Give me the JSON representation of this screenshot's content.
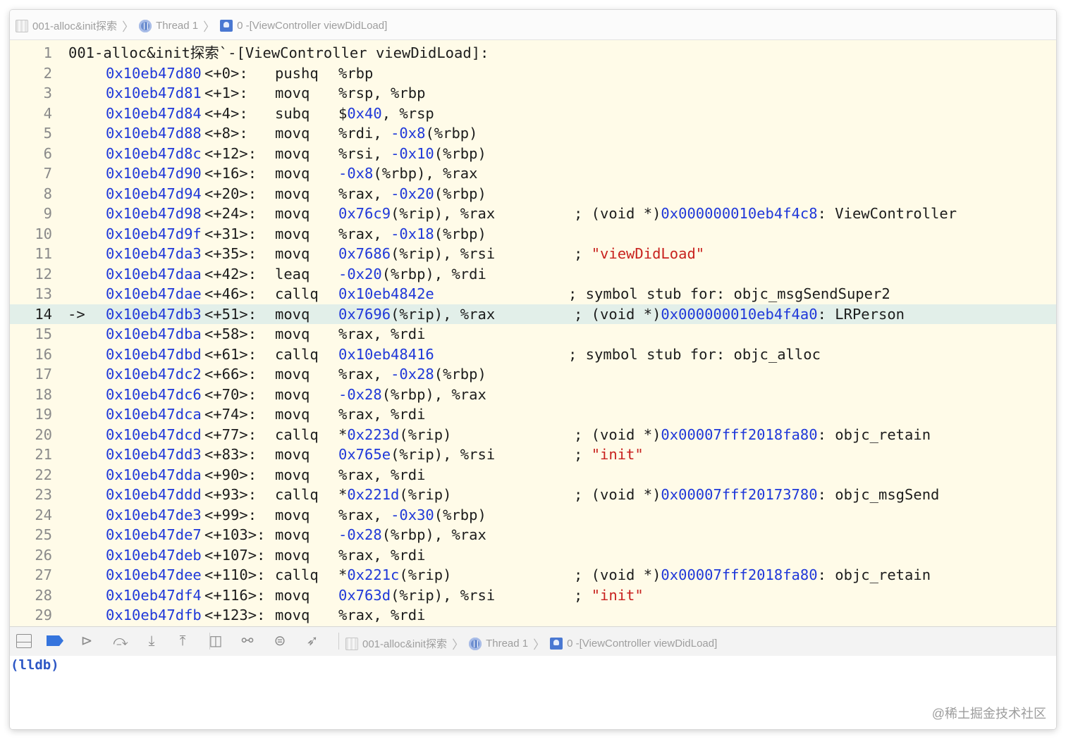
{
  "breadcrumb": {
    "project": "001-alloc&init探索",
    "thread": "Thread 1",
    "frame": "0 -[ViewController viewDidLoad]"
  },
  "editor": {
    "header": "001-alloc&init探索`-[ViewController viewDidLoad]:",
    "current_line": 14,
    "lines": [
      {
        "n": "1"
      },
      {
        "n": "2",
        "addr": "0x10eb47d80",
        "off": "<+0>:",
        "ins": "pushq",
        "args": [
          {
            "t": "%rbp"
          }
        ]
      },
      {
        "n": "3",
        "addr": "0x10eb47d81",
        "off": "<+1>:",
        "ins": "movq",
        "args": [
          {
            "t": "%rsp, %rbp"
          }
        ]
      },
      {
        "n": "4",
        "addr": "0x10eb47d84",
        "off": "<+4>:",
        "ins": "subq",
        "args": [
          {
            "t": "$"
          },
          {
            "t": "0x40",
            "c": "hex"
          },
          {
            "t": ", %rsp"
          }
        ]
      },
      {
        "n": "5",
        "addr": "0x10eb47d88",
        "off": "<+8>:",
        "ins": "movq",
        "args": [
          {
            "t": "%rdi, "
          },
          {
            "t": "-0x8",
            "c": "hex"
          },
          {
            "t": "(%rbp)"
          }
        ]
      },
      {
        "n": "6",
        "addr": "0x10eb47d8c",
        "off": "<+12>:",
        "ins": "movq",
        "args": [
          {
            "t": "%rsi, "
          },
          {
            "t": "-0x10",
            "c": "hex"
          },
          {
            "t": "(%rbp)"
          }
        ]
      },
      {
        "n": "7",
        "addr": "0x10eb47d90",
        "off": "<+16>:",
        "ins": "movq",
        "args": [
          {
            "t": "-0x8",
            "c": "hex"
          },
          {
            "t": "(%rbp), %rax"
          }
        ]
      },
      {
        "n": "8",
        "addr": "0x10eb47d94",
        "off": "<+20>:",
        "ins": "movq",
        "args": [
          {
            "t": "%rax, "
          },
          {
            "t": "-0x20",
            "c": "hex"
          },
          {
            "t": "(%rbp)"
          }
        ]
      },
      {
        "n": "9",
        "addr": "0x10eb47d98",
        "off": "<+24>:",
        "ins": "movq",
        "args": [
          {
            "t": "0x76c9",
            "c": "hex"
          },
          {
            "t": "(%rip), %rax"
          }
        ],
        "cpos": "far",
        "comment": [
          {
            "t": "; (void *)"
          },
          {
            "t": "0x000000010eb4f4c8",
            "c": "hex"
          },
          {
            "t": ": ViewController"
          }
        ]
      },
      {
        "n": "10",
        "addr": "0x10eb47d9f",
        "off": "<+31>:",
        "ins": "movq",
        "args": [
          {
            "t": "%rax, "
          },
          {
            "t": "-0x18",
            "c": "hex"
          },
          {
            "t": "(%rbp)"
          }
        ]
      },
      {
        "n": "11",
        "addr": "0x10eb47da3",
        "off": "<+35>:",
        "ins": "movq",
        "args": [
          {
            "t": "0x7686",
            "c": "hex"
          },
          {
            "t": "(%rip), %rsi"
          }
        ],
        "cpos": "far",
        "comment": [
          {
            "t": "; "
          },
          {
            "t": "\"viewDidLoad\"",
            "c": "str"
          }
        ]
      },
      {
        "n": "12",
        "addr": "0x10eb47daa",
        "off": "<+42>:",
        "ins": "leaq",
        "args": [
          {
            "t": "-0x20",
            "c": "hex"
          },
          {
            "t": "(%rbp), %rdi"
          }
        ]
      },
      {
        "n": "13",
        "addr": "0x10eb47dae",
        "off": "<+46>:",
        "ins": "callq",
        "args": [
          {
            "t": "0x10eb4842e",
            "c": "hex"
          }
        ],
        "cpos": "near",
        "comment": [
          {
            "t": "; symbol stub for: objc_msgSendSuper2"
          }
        ]
      },
      {
        "n": "14",
        "arrow": "->",
        "addr": "0x10eb47db3",
        "off": "<+51>:",
        "ins": "movq",
        "args": [
          {
            "t": "0x7696",
            "c": "hex"
          },
          {
            "t": "(%rip), %rax"
          }
        ],
        "cpos": "far",
        "comment": [
          {
            "t": "; (void *)"
          },
          {
            "t": "0x000000010eb4f4a0",
            "c": "hex"
          },
          {
            "t": ": LRPerson"
          }
        ]
      },
      {
        "n": "15",
        "addr": "0x10eb47dba",
        "off": "<+58>:",
        "ins": "movq",
        "args": [
          {
            "t": "%rax, %rdi"
          }
        ]
      },
      {
        "n": "16",
        "addr": "0x10eb47dbd",
        "off": "<+61>:",
        "ins": "callq",
        "args": [
          {
            "t": "0x10eb48416",
            "c": "hex"
          }
        ],
        "cpos": "near",
        "comment": [
          {
            "t": "; symbol stub for: objc_alloc"
          }
        ]
      },
      {
        "n": "17",
        "addr": "0x10eb47dc2",
        "off": "<+66>:",
        "ins": "movq",
        "args": [
          {
            "t": "%rax, "
          },
          {
            "t": "-0x28",
            "c": "hex"
          },
          {
            "t": "(%rbp)"
          }
        ]
      },
      {
        "n": "18",
        "addr": "0x10eb47dc6",
        "off": "<+70>:",
        "ins": "movq",
        "args": [
          {
            "t": "-0x28",
            "c": "hex"
          },
          {
            "t": "(%rbp), %rax"
          }
        ]
      },
      {
        "n": "19",
        "addr": "0x10eb47dca",
        "off": "<+74>:",
        "ins": "movq",
        "args": [
          {
            "t": "%rax, %rdi"
          }
        ]
      },
      {
        "n": "20",
        "addr": "0x10eb47dcd",
        "off": "<+77>:",
        "ins": "callq",
        "args": [
          {
            "t": "*"
          },
          {
            "t": "0x223d",
            "c": "hex"
          },
          {
            "t": "(%rip)"
          }
        ],
        "cpos": "far",
        "comment": [
          {
            "t": "; (void *)"
          },
          {
            "t": "0x00007fff2018fa80",
            "c": "hex"
          },
          {
            "t": ": objc_retain"
          }
        ]
      },
      {
        "n": "21",
        "addr": "0x10eb47dd3",
        "off": "<+83>:",
        "ins": "movq",
        "args": [
          {
            "t": "0x765e",
            "c": "hex"
          },
          {
            "t": "(%rip), %rsi"
          }
        ],
        "cpos": "far",
        "comment": [
          {
            "t": "; "
          },
          {
            "t": "\"init\"",
            "c": "str"
          }
        ]
      },
      {
        "n": "22",
        "addr": "0x10eb47dda",
        "off": "<+90>:",
        "ins": "movq",
        "args": [
          {
            "t": "%rax, %rdi"
          }
        ]
      },
      {
        "n": "23",
        "addr": "0x10eb47ddd",
        "off": "<+93>:",
        "ins": "callq",
        "args": [
          {
            "t": "*"
          },
          {
            "t": "0x221d",
            "c": "hex"
          },
          {
            "t": "(%rip)"
          }
        ],
        "cpos": "far",
        "comment": [
          {
            "t": "; (void *)"
          },
          {
            "t": "0x00007fff20173780",
            "c": "hex"
          },
          {
            "t": ": objc_msgSend"
          }
        ]
      },
      {
        "n": "24",
        "addr": "0x10eb47de3",
        "off": "<+99>:",
        "ins": "movq",
        "args": [
          {
            "t": "%rax, "
          },
          {
            "t": "-0x30",
            "c": "hex"
          },
          {
            "t": "(%rbp)"
          }
        ]
      },
      {
        "n": "25",
        "addr": "0x10eb47de7",
        "off": "<+103>:",
        "ins": "movq",
        "args": [
          {
            "t": "-0x28",
            "c": "hex"
          },
          {
            "t": "(%rbp), %rax"
          }
        ]
      },
      {
        "n": "26",
        "addr": "0x10eb47deb",
        "off": "<+107>:",
        "ins": "movq",
        "args": [
          {
            "t": "%rax, %rdi"
          }
        ]
      },
      {
        "n": "27",
        "addr": "0x10eb47dee",
        "off": "<+110>:",
        "ins": "callq",
        "args": [
          {
            "t": "*"
          },
          {
            "t": "0x221c",
            "c": "hex"
          },
          {
            "t": "(%rip)"
          }
        ],
        "cpos": "far",
        "comment": [
          {
            "t": "; (void *)"
          },
          {
            "t": "0x00007fff2018fa80",
            "c": "hex"
          },
          {
            "t": ": objc_retain"
          }
        ]
      },
      {
        "n": "28",
        "addr": "0x10eb47df4",
        "off": "<+116>:",
        "ins": "movq",
        "args": [
          {
            "t": "0x763d",
            "c": "hex"
          },
          {
            "t": "(%rip), %rsi"
          }
        ],
        "cpos": "far",
        "comment": [
          {
            "t": "; "
          },
          {
            "t": "\"init\"",
            "c": "str"
          }
        ]
      },
      {
        "n": "29",
        "addr": "0x10eb47dfb",
        "off": "<+123>:",
        "ins": "movq",
        "args": [
          {
            "t": "%rax, %rdi"
          }
        ]
      }
    ]
  },
  "debug_toolbar": {
    "buttons": [
      {
        "name": "hide-debug-area-button",
        "icon": "panel-icon"
      },
      {
        "name": "breakpoints-toggle-button",
        "icon": "breakpoint-icon"
      },
      {
        "name": "continue-button",
        "icon": "continue-icon",
        "glyph": "⊳"
      },
      {
        "name": "step-over-button",
        "icon": "step-over-icon",
        "glyph": "⤼"
      },
      {
        "name": "step-into-button",
        "icon": "step-into-icon",
        "glyph": "⤓"
      },
      {
        "name": "step-out-button",
        "icon": "step-out-icon",
        "glyph": "⤒"
      },
      {
        "name": "view-hierarchy-button",
        "icon": "view-hierarchy-icon",
        "glyph": "◫"
      },
      {
        "name": "memory-graph-button",
        "icon": "memory-graph-icon",
        "glyph": "⚯"
      },
      {
        "name": "environment-overrides-button",
        "icon": "environment-overrides-icon",
        "glyph": "⊜"
      },
      {
        "name": "simulate-location-button",
        "icon": "location-arrow-icon",
        "glyph": "➶"
      }
    ]
  },
  "console": {
    "prompt": "(lldb)"
  },
  "watermark": "@稀土掘金技术社区"
}
